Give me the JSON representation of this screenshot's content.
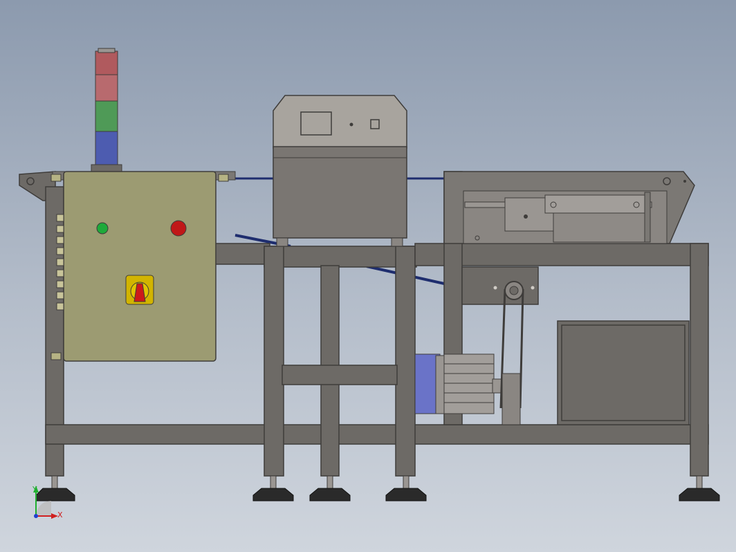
{
  "viewport": {
    "background_top": "#8c9aae",
    "background_bottom": "#cfd5dd"
  },
  "colors": {
    "frame": "#6d6a66",
    "frame_edge": "#3e3c3a",
    "control_box": "#9c9b72",
    "detector_top": "#a8a49e",
    "detector_body": "#7a7672",
    "motor": "#6a73c8",
    "belt": "#1e2d6e",
    "lamp_red": "#b05a5e",
    "lamp_green": "#4f9a57",
    "lamp_blue": "#4d5cb0",
    "button_green": "#1eaa3a",
    "button_red": "#c01818",
    "switch_plate": "#d2b400",
    "switch_knob": "#cc1a1a",
    "axis_x": "#d02020",
    "axis_y": "#20b030",
    "axis_z": "#2040d0"
  },
  "components": {
    "signal_tower": {
      "lamps": [
        "red",
        "red",
        "green",
        "blue"
      ]
    },
    "control_cabinet": {
      "buttons": [
        "green",
        "red"
      ],
      "switch": "rotary",
      "terminal_blocks": 9
    },
    "metal_detector": {
      "display": "screen",
      "indicators": 2
    },
    "conveyor": {
      "belt": "return-belt"
    },
    "drive_motor": {
      "type": "geared-motor"
    },
    "leveling_feet": 5
  },
  "triad": {
    "x_label": "X",
    "y_label": "Y"
  }
}
